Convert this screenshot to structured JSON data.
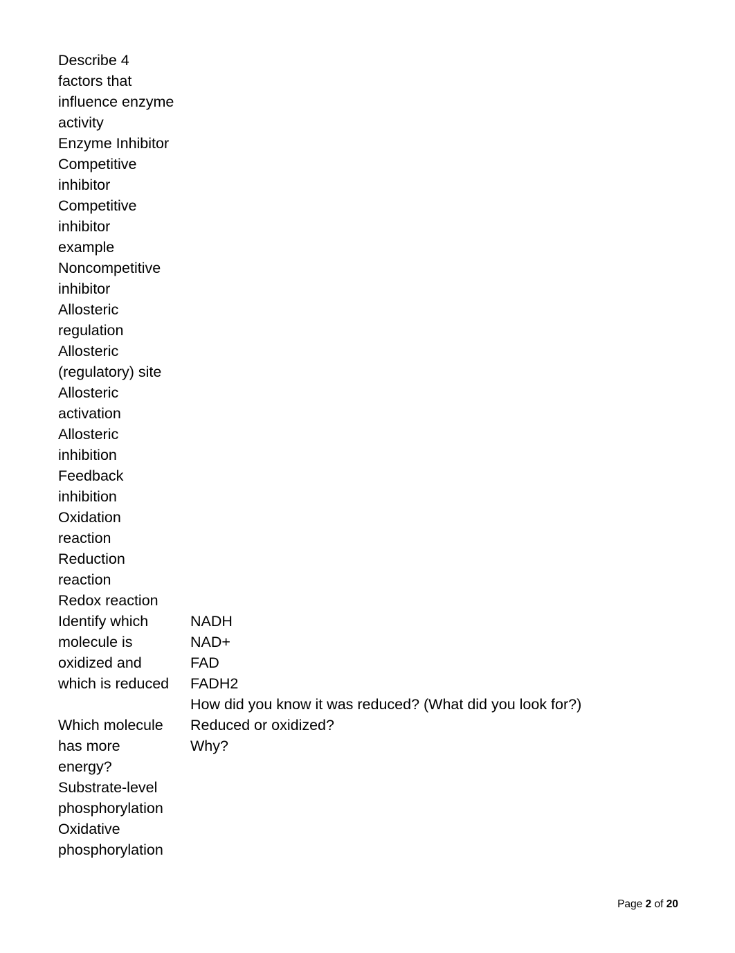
{
  "document": {
    "page_footer": {
      "prefix": "Page ",
      "current_page": "2",
      "middle": " of ",
      "total_pages": "20"
    },
    "rows": [
      {
        "term_lines": [
          "Describe 4",
          "factors that",
          "influence enzyme",
          "activity"
        ],
        "answer_lines": []
      },
      {
        "term_lines": [
          "Enzyme Inhibitor"
        ],
        "answer_lines": []
      },
      {
        "term_lines": [
          "Competitive",
          "inhibitor"
        ],
        "answer_lines": []
      },
      {
        "term_lines": [
          "Competitive",
          "inhibitor",
          "example"
        ],
        "answer_lines": []
      },
      {
        "term_lines": [
          "Noncompetitive",
          "inhibitor"
        ],
        "answer_lines": []
      },
      {
        "term_lines": [
          "Allosteric",
          "regulation"
        ],
        "answer_lines": []
      },
      {
        "term_lines": [
          "Allosteric",
          "(regulatory) site"
        ],
        "answer_lines": []
      },
      {
        "term_lines": [
          "Allosteric",
          "activation"
        ],
        "answer_lines": []
      },
      {
        "term_lines": [
          "Allosteric",
          "inhibition"
        ],
        "answer_lines": []
      },
      {
        "term_lines": [
          "Feedback",
          "inhibition"
        ],
        "answer_lines": []
      },
      {
        "term_lines": [
          "Oxidation",
          "reaction"
        ],
        "answer_lines": []
      },
      {
        "term_lines": [
          "Reduction",
          "reaction"
        ],
        "answer_lines": []
      },
      {
        "term_lines": [
          "Redox reaction"
        ],
        "answer_lines": []
      },
      {
        "term_lines": [
          "Identify which",
          "molecule is",
          "oxidized and",
          "which is reduced"
        ],
        "answer_lines": [
          "NADH",
          "NAD+",
          "FAD",
          "FADH2",
          "How did you know it was reduced? (What did you look for?)"
        ]
      },
      {
        "term_lines": [
          "Which molecule",
          "has more",
          "energy?"
        ],
        "answer_lines": [
          "Reduced or oxidized?",
          "Why?"
        ]
      },
      {
        "term_lines": [
          "Substrate-level",
          "phosphorylation"
        ],
        "answer_lines": []
      },
      {
        "term_lines": [
          "Oxidative",
          "phosphorylation"
        ],
        "answer_lines": []
      }
    ]
  }
}
